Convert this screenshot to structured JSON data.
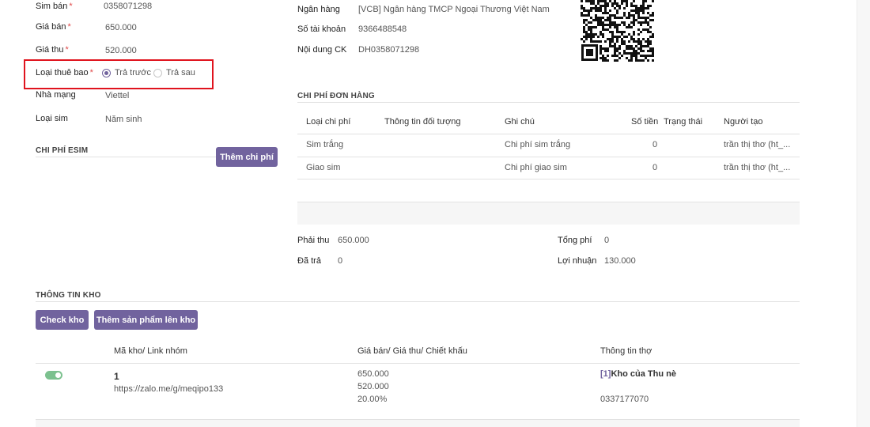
{
  "form": {
    "sim_ban_label": "Sim bán",
    "sim_ban_value": "0358071298",
    "gia_ban_label": "Giá bán",
    "gia_ban_value": "650.000",
    "gia_thu_label": "Giá thu",
    "gia_thu_value": "520.000",
    "loai_thue_bao_label": "Loại thuê bao",
    "option_tra_truoc": "Trả trước",
    "option_tra_sau": "Trả sau",
    "nha_mang_label": "Nhà mạng",
    "nha_mang_value": "Viettel",
    "loai_sim_label": "Loại sim",
    "loai_sim_value": "Năm sinh",
    "required_mark": "*"
  },
  "bank": {
    "ngan_hang_label": "Ngân hàng",
    "ngan_hang_value": "[VCB] Ngân hàng TMCP Ngoại Thương Việt Nam",
    "so_tai_khoan_label": "Số tài khoản",
    "so_tai_khoan_value": "9366488548",
    "noi_dung_label": "Nội dung CK",
    "noi_dung_value": "DH0358071298"
  },
  "esim": {
    "title": "CHI PHÍ ESIM",
    "add_button": "Thêm chi phí"
  },
  "order_costs": {
    "title": "CHI PHÍ ĐƠN HÀNG",
    "headers": [
      "Loại chi phí",
      "Thông tin đối tượng",
      "Ghi chú",
      "Số tiền",
      "Trạng thái",
      "Người tạo"
    ],
    "rows": [
      {
        "type": "Sim trắng",
        "info": "",
        "note": "Chi phí sim trắng",
        "amount": "0",
        "status": "",
        "creator": "trần thị thơ (ht_..."
      },
      {
        "type": "Giao sim",
        "info": "",
        "note": "Chi phí giao sim",
        "amount": "0",
        "status": "",
        "creator": "trần thị thơ (ht_..."
      }
    ]
  },
  "summary": {
    "phai_thu_label": "Phải thu",
    "phai_thu_value": "650.000",
    "da_tra_label": "Đã trả",
    "da_tra_value": "0",
    "tong_phi_label": "Tổng phí",
    "tong_phi_value": "0",
    "loi_nhuan_label": "Lợi nhuận",
    "loi_nhuan_value": "130.000"
  },
  "warehouse": {
    "title": "THÔNG TIN KHO",
    "check_button": "Check kho",
    "add_product_button": "Thêm sản phẩm lên kho",
    "headers": [
      "Mã kho/ Link nhóm",
      "Giá bán/ Giá thu/ Chiết khấu",
      "Thông tin thợ"
    ],
    "row": {
      "code": "1",
      "link": "https://zalo.me/g/meqipo133",
      "price_sell": "650.000",
      "price_collect": "520.000",
      "discount": "20.00%",
      "worker_id": "[1]",
      "worker_name": "Kho của Thu nè",
      "worker_phone": "0337177070"
    }
  },
  "colors": {
    "accent": "#71639e",
    "highlight_border": "#e0141e",
    "toggle_on": "#7cc18f"
  }
}
